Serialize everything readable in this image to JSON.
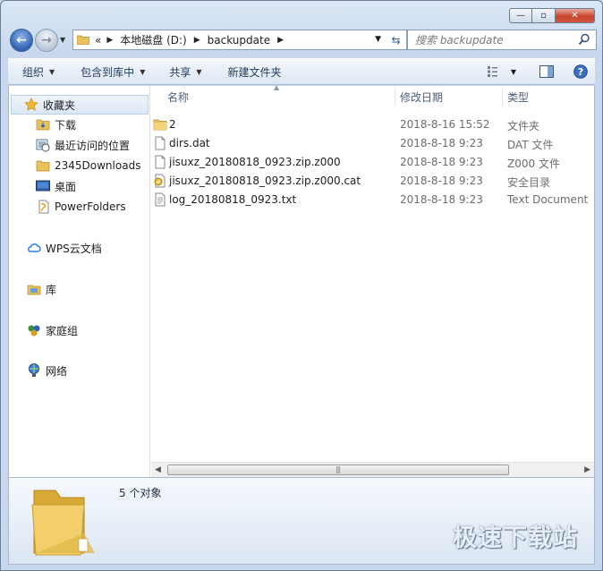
{
  "window": {
    "caption_min": "—",
    "caption_max": "▫",
    "caption_close": "✕"
  },
  "address": {
    "overflow": "«",
    "crumbs": [
      "本地磁盘 (D:)",
      "backupdate"
    ],
    "search_placeholder": "搜索 backupdate"
  },
  "toolbar": {
    "organize": "组织",
    "include_in_library": "包含到库中",
    "share": "共享",
    "new_folder": "新建文件夹"
  },
  "navpane": {
    "favorites": "收藏夹",
    "fav_items": [
      "下载",
      "最近访问的位置",
      "2345Downloads",
      "桌面",
      "PowerFolders"
    ],
    "wps": "WPS云文档",
    "library": "库",
    "homegroup": "家庭组",
    "network": "网络"
  },
  "columns": {
    "name": "名称",
    "date": "修改日期",
    "type": "类型"
  },
  "files": [
    {
      "name": "2",
      "date": "2018-8-16 15:52",
      "type": "文件夹",
      "icon": "folder-icon"
    },
    {
      "name": "dirs.dat",
      "date": "2018-8-18 9:23",
      "type": "DAT 文件",
      "icon": "file-icon"
    },
    {
      "name": "jisuxz_20180818_0923.zip.z000",
      "date": "2018-8-18 9:23",
      "type": "Z000 文件",
      "icon": "file-icon"
    },
    {
      "name": "jisuxz_20180818_0923.zip.z000.cat",
      "date": "2018-8-18 9:23",
      "type": "安全目录",
      "icon": "security-catalog-icon"
    },
    {
      "name": "log_20180818_0923.txt",
      "date": "2018-8-18 9:23",
      "type": "Text Document",
      "icon": "text-file-icon"
    }
  ],
  "details": {
    "count": "5 个对象"
  },
  "watermark": "极速下载站",
  "colors": {
    "accent": "#2f62b5",
    "folder": "#e8c25c",
    "close": "#c9452f"
  }
}
